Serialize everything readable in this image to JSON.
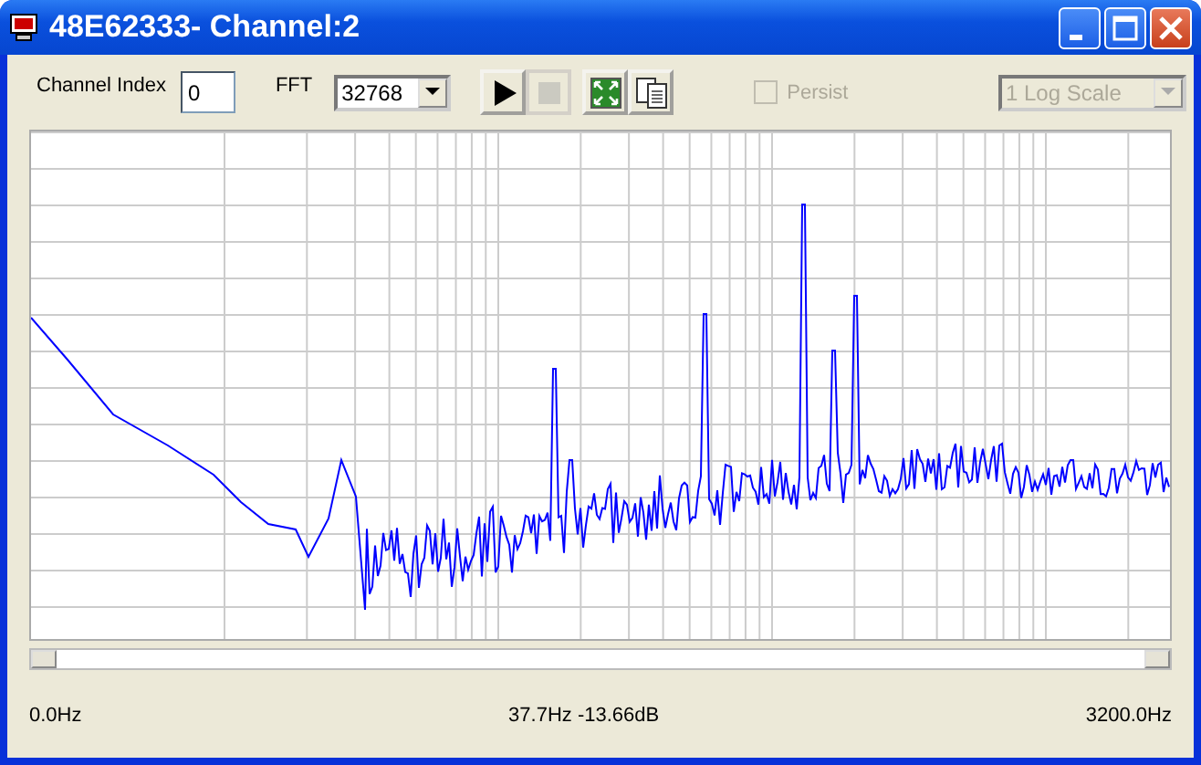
{
  "window": {
    "title": "48E62333- Channel:2"
  },
  "toolbar": {
    "channel_index": {
      "label": "Channel Index",
      "value": "0"
    },
    "fft": {
      "label": "FFT",
      "value": "32768"
    },
    "buttons": [
      {
        "kind": "play",
        "disabled": false
      },
      {
        "kind": "stop",
        "disabled": true
      },
      {
        "kind": "fit",
        "disabled": false
      },
      {
        "kind": "copy",
        "disabled": false
      }
    ],
    "persist": {
      "label": "Persist",
      "checked": false,
      "disabled": true
    },
    "scale": {
      "value": "1 Log Scale",
      "disabled": true
    }
  },
  "status_bar": {
    "left": "0.0Hz",
    "center": "37.7Hz -13.66dB",
    "right": "3200.0Hz"
  }
}
